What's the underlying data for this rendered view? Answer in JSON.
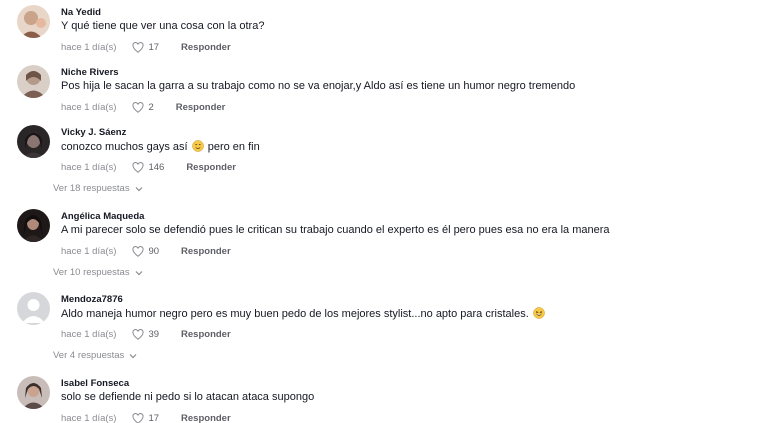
{
  "comments": [
    {
      "username": "Na Yedid",
      "text": "Y qué tiene que ver una cosa con la otra?",
      "time": "hace 1 día(s)",
      "likes": "17",
      "reply_label": "Responder",
      "avatar_color": "#c9a38a"
    },
    {
      "username": "Niche Rivers",
      "text": "Pos hija le sacan la garra a su trabajo como no se va enojar,y Aldo así es tiene un humor negro tremendo",
      "time": "hace 1 día(s)",
      "likes": "2",
      "reply_label": "Responder",
      "avatar_color": "#b49a88"
    },
    {
      "username": "Vicky J. Sáenz",
      "text_before": "conozco muchos gays así",
      "text_emoji": "smiling-face",
      "text_after": "pero en fin",
      "time": "hace 1 día(s)",
      "likes": "146",
      "reply_label": "Responder",
      "replies_label": "Ver 18 respuestas",
      "avatar_color": "#4a4446"
    },
    {
      "username": "Angélica Maqueda",
      "text": "A mi parecer solo se defendió pues le critican su trabajo cuando el experto es él pero pues esa no era la manera",
      "time": "hace 1 día(s)",
      "likes": "90",
      "reply_label": "Responder",
      "replies_label": "Ver 10 respuestas",
      "avatar_color": "#2e2624"
    },
    {
      "username": "Mendoza7876",
      "text_before": "Aldo maneja humor negro pero es muy buen pedo de los mejores stylist...no apto para cristales.",
      "text_emoji": "laughing-face",
      "time": "hace 1 día(s)",
      "likes": "39",
      "reply_label": "Responder",
      "replies_label": "Ver 4 respuestas",
      "avatar_color": "#d6d7da"
    },
    {
      "username": "Isabel Fonseca",
      "text": "solo se defiende ni pedo si lo atacan ataca supongo",
      "time": "hace 1 día(s)",
      "likes": "17",
      "reply_label": "Responder",
      "avatar_color": "#5a4a48"
    }
  ]
}
